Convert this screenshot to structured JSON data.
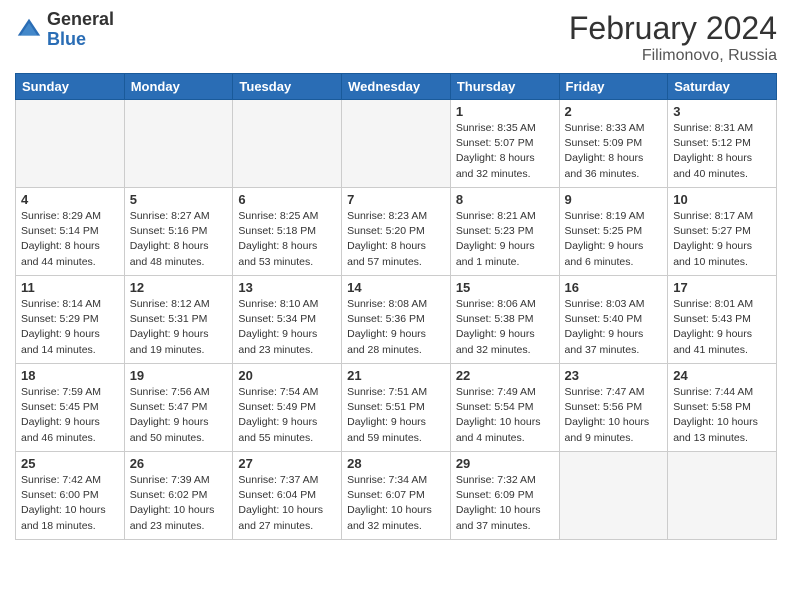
{
  "header": {
    "logo_general": "General",
    "logo_blue": "Blue",
    "month_title": "February 2024",
    "location": "Filimonovo, Russia"
  },
  "weekdays": [
    "Sunday",
    "Monday",
    "Tuesday",
    "Wednesday",
    "Thursday",
    "Friday",
    "Saturday"
  ],
  "weeks": [
    [
      {
        "day": "",
        "empty": true
      },
      {
        "day": "",
        "empty": true
      },
      {
        "day": "",
        "empty": true
      },
      {
        "day": "",
        "empty": true
      },
      {
        "day": "1",
        "sunrise": "8:35 AM",
        "sunset": "5:07 PM",
        "daylight": "8 hours and 32 minutes."
      },
      {
        "day": "2",
        "sunrise": "8:33 AM",
        "sunset": "5:09 PM",
        "daylight": "8 hours and 36 minutes."
      },
      {
        "day": "3",
        "sunrise": "8:31 AM",
        "sunset": "5:12 PM",
        "daylight": "8 hours and 40 minutes."
      }
    ],
    [
      {
        "day": "4",
        "sunrise": "8:29 AM",
        "sunset": "5:14 PM",
        "daylight": "8 hours and 44 minutes."
      },
      {
        "day": "5",
        "sunrise": "8:27 AM",
        "sunset": "5:16 PM",
        "daylight": "8 hours and 48 minutes."
      },
      {
        "day": "6",
        "sunrise": "8:25 AM",
        "sunset": "5:18 PM",
        "daylight": "8 hours and 53 minutes."
      },
      {
        "day": "7",
        "sunrise": "8:23 AM",
        "sunset": "5:20 PM",
        "daylight": "8 hours and 57 minutes."
      },
      {
        "day": "8",
        "sunrise": "8:21 AM",
        "sunset": "5:23 PM",
        "daylight": "9 hours and 1 minute."
      },
      {
        "day": "9",
        "sunrise": "8:19 AM",
        "sunset": "5:25 PM",
        "daylight": "9 hours and 6 minutes."
      },
      {
        "day": "10",
        "sunrise": "8:17 AM",
        "sunset": "5:27 PM",
        "daylight": "9 hours and 10 minutes."
      }
    ],
    [
      {
        "day": "11",
        "sunrise": "8:14 AM",
        "sunset": "5:29 PM",
        "daylight": "9 hours and 14 minutes."
      },
      {
        "day": "12",
        "sunrise": "8:12 AM",
        "sunset": "5:31 PM",
        "daylight": "9 hours and 19 minutes."
      },
      {
        "day": "13",
        "sunrise": "8:10 AM",
        "sunset": "5:34 PM",
        "daylight": "9 hours and 23 minutes."
      },
      {
        "day": "14",
        "sunrise": "8:08 AM",
        "sunset": "5:36 PM",
        "daylight": "9 hours and 28 minutes."
      },
      {
        "day": "15",
        "sunrise": "8:06 AM",
        "sunset": "5:38 PM",
        "daylight": "9 hours and 32 minutes."
      },
      {
        "day": "16",
        "sunrise": "8:03 AM",
        "sunset": "5:40 PM",
        "daylight": "9 hours and 37 minutes."
      },
      {
        "day": "17",
        "sunrise": "8:01 AM",
        "sunset": "5:43 PM",
        "daylight": "9 hours and 41 minutes."
      }
    ],
    [
      {
        "day": "18",
        "sunrise": "7:59 AM",
        "sunset": "5:45 PM",
        "daylight": "9 hours and 46 minutes."
      },
      {
        "day": "19",
        "sunrise": "7:56 AM",
        "sunset": "5:47 PM",
        "daylight": "9 hours and 50 minutes."
      },
      {
        "day": "20",
        "sunrise": "7:54 AM",
        "sunset": "5:49 PM",
        "daylight": "9 hours and 55 minutes."
      },
      {
        "day": "21",
        "sunrise": "7:51 AM",
        "sunset": "5:51 PM",
        "daylight": "9 hours and 59 minutes."
      },
      {
        "day": "22",
        "sunrise": "7:49 AM",
        "sunset": "5:54 PM",
        "daylight": "10 hours and 4 minutes."
      },
      {
        "day": "23",
        "sunrise": "7:47 AM",
        "sunset": "5:56 PM",
        "daylight": "10 hours and 9 minutes."
      },
      {
        "day": "24",
        "sunrise": "7:44 AM",
        "sunset": "5:58 PM",
        "daylight": "10 hours and 13 minutes."
      }
    ],
    [
      {
        "day": "25",
        "sunrise": "7:42 AM",
        "sunset": "6:00 PM",
        "daylight": "10 hours and 18 minutes."
      },
      {
        "day": "26",
        "sunrise": "7:39 AM",
        "sunset": "6:02 PM",
        "daylight": "10 hours and 23 minutes."
      },
      {
        "day": "27",
        "sunrise": "7:37 AM",
        "sunset": "6:04 PM",
        "daylight": "10 hours and 27 minutes."
      },
      {
        "day": "28",
        "sunrise": "7:34 AM",
        "sunset": "6:07 PM",
        "daylight": "10 hours and 32 minutes."
      },
      {
        "day": "29",
        "sunrise": "7:32 AM",
        "sunset": "6:09 PM",
        "daylight": "10 hours and 37 minutes."
      },
      {
        "day": "",
        "empty": true
      },
      {
        "day": "",
        "empty": true
      }
    ]
  ]
}
